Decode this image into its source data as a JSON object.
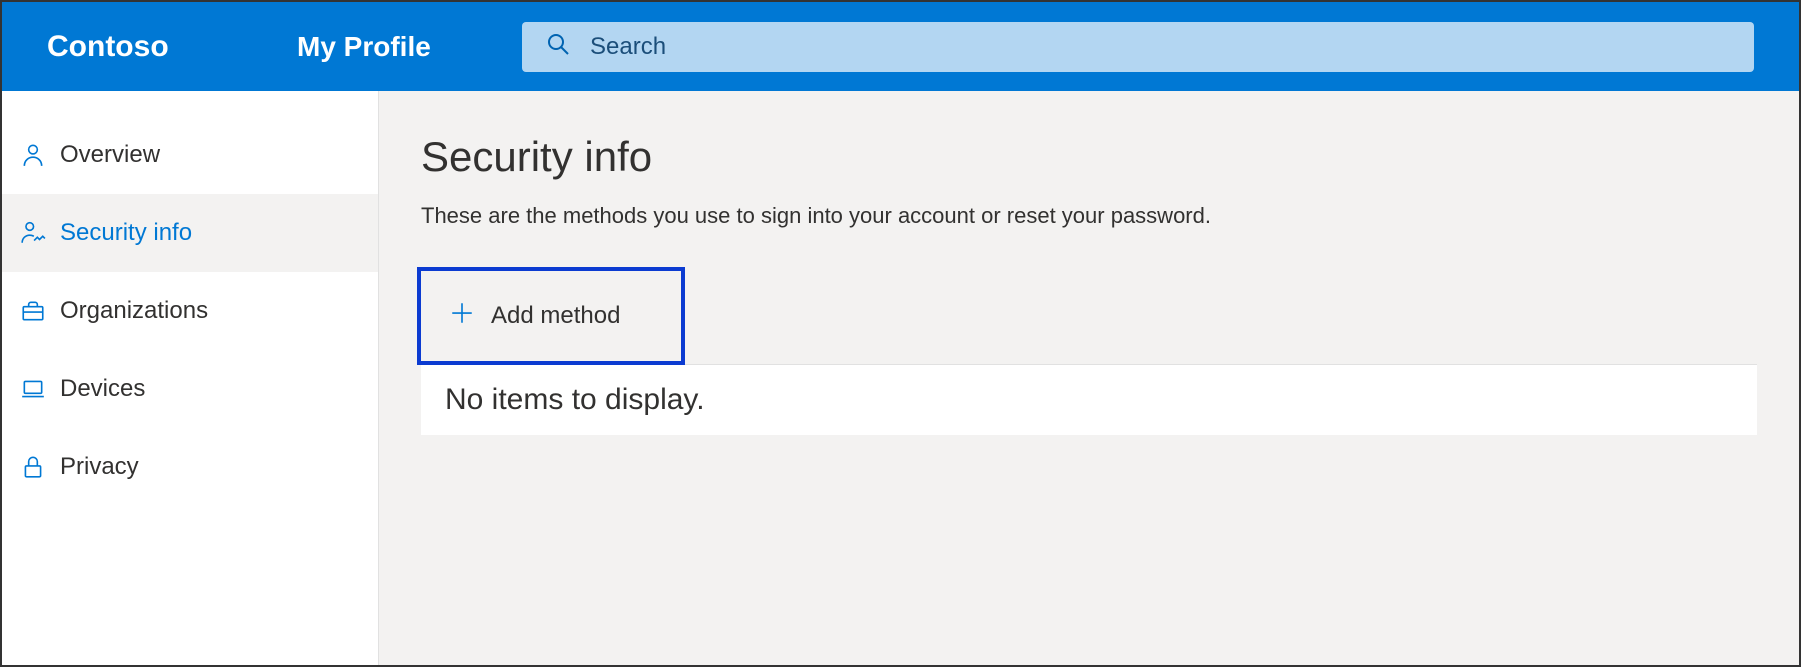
{
  "header": {
    "brand": "Contoso",
    "title": "My Profile",
    "search_placeholder": "Search"
  },
  "sidebar": {
    "items": [
      {
        "label": "Overview",
        "icon": "person-icon",
        "active": false
      },
      {
        "label": "Security info",
        "icon": "person-key-icon",
        "active": true
      },
      {
        "label": "Organizations",
        "icon": "briefcase-icon",
        "active": false
      },
      {
        "label": "Devices",
        "icon": "laptop-icon",
        "active": false
      },
      {
        "label": "Privacy",
        "icon": "lock-icon",
        "active": false
      }
    ]
  },
  "main": {
    "title": "Security info",
    "subtitle": "These are the methods you use to sign into your account or reset your password.",
    "add_method_label": "Add method",
    "empty_message": "No items to display."
  },
  "colors": {
    "accent": "#0078d4",
    "highlight_border": "#0b3bd1"
  }
}
